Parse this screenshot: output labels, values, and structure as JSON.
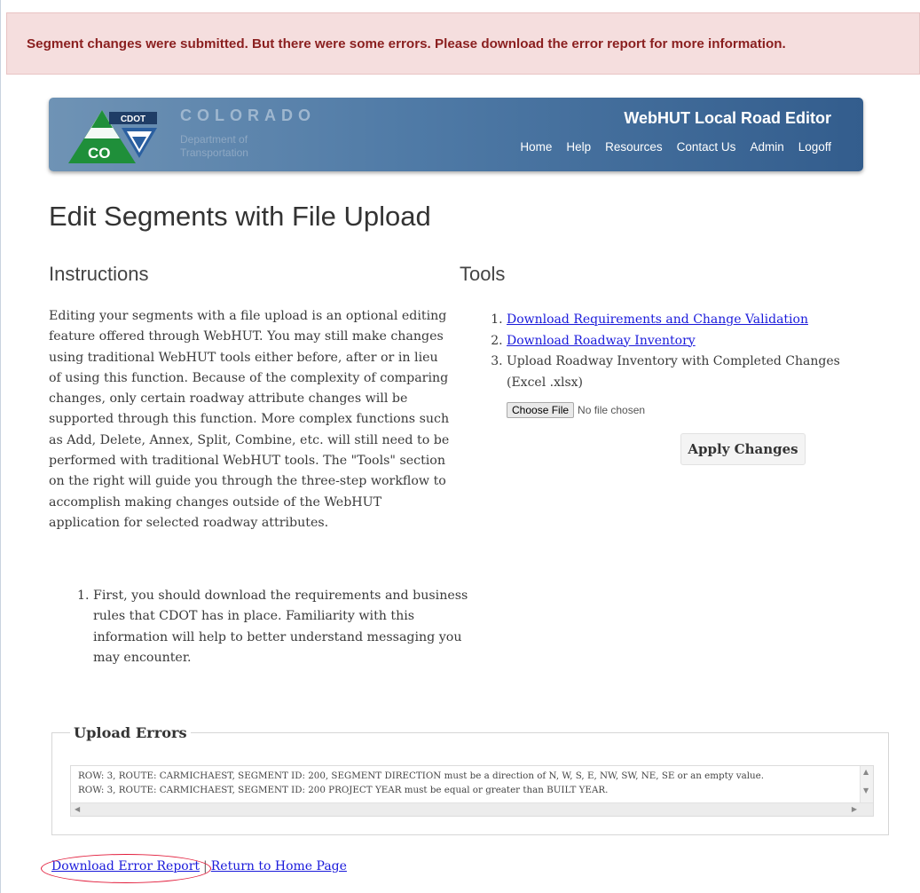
{
  "alert": {
    "message": "Segment changes were submitted. But there were some errors. Please download the error report for more information."
  },
  "header": {
    "logo_badge": "CDOT",
    "logo_letters": "CO",
    "brand_name": "COLORADO",
    "brand_sub": "Department of Transportation",
    "app_title": "WebHUT Local Road Editor",
    "nav": [
      "Home",
      "Help",
      "Resources",
      "Contact Us",
      "Admin",
      "Logoff"
    ]
  },
  "page_title": "Edit Segments with File Upload",
  "instructions": {
    "heading": "Instructions",
    "paragraph": "Editing your segments with a file upload is an optional editing feature offered through WebHUT. You may still make changes using traditional WebHUT tools either before, after or in lieu of using this function. Because of the complexity of comparing changes, only certain roadway attribute changes will be supported through this function. More complex functions such as Add, Delete, Annex, Split, Combine, etc. will still need to be performed with traditional WebHUT tools. The \"Tools\" section on the right will guide you through the three-step workflow to accomplish making changes outside of the WebHUT application for selected roadway attributes.",
    "steps": [
      "First, you should download the requirements and business rules that CDOT has in place. Familiarity with this information will help to better understand messaging you may encounter."
    ]
  },
  "tools": {
    "heading": "Tools",
    "items": [
      "Download Requirements and Change Validation",
      "Download Roadway Inventory",
      "Upload Roadway Inventory with Completed Changes (Excel .xlsx)"
    ],
    "file_button": "Choose File",
    "file_status": "No file chosen",
    "apply_button": "Apply Changes"
  },
  "upload_errors": {
    "legend": "Upload Errors",
    "lines": [
      "ROW: 3, ROUTE: CARMICHAEST, SEGMENT ID: 200, SEGMENT DIRECTION must be a direction of N, W, S, E, NW, SW, NE, SE or an empty value.",
      "ROW: 3, ROUTE: CARMICHAEST, SEGMENT ID: 200 PROJECT YEAR must be equal or greater than BUILT YEAR."
    ]
  },
  "bottom_links": {
    "download_error_report": "Download Error Report",
    "separator": "|",
    "return_home": "Return to Home Page"
  }
}
